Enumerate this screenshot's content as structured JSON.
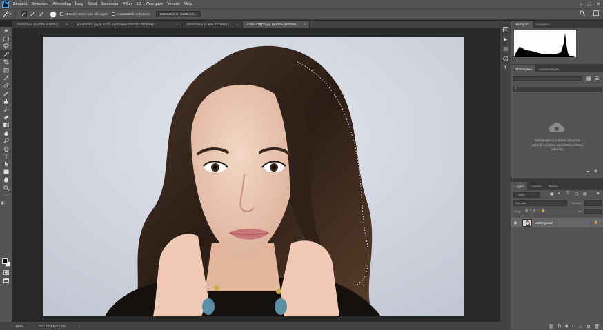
{
  "app": {
    "logo": "Ps"
  },
  "menu": [
    "Bestand",
    "Bewerken",
    "Afbeelding",
    "Laag",
    "Tekst",
    "Selecteren",
    "Filter",
    "3D",
    "Weergave",
    "Venster",
    "Help"
  ],
  "window_controls": {
    "minimize": "–",
    "maximize": "□",
    "close": "✕"
  },
  "options": {
    "brush_size": "47",
    "sample_all_layers": "Monster nemen van alle lagen",
    "auto_enhance": "Automatisch verbeteren",
    "select_mask_button": "Selecteren en maskeren..."
  },
  "tabs": [
    {
      "label": "Naamloos-1 @ 100% (RGB/8) *",
      "close": "×"
    },
    {
      "label": "girl-1848454.jpg @ 41,5% (radbouwne-2262233, RGB/8#) *",
      "close": "×"
    },
    {
      "label": "Naamloos-2 @ 50% (RGB/8#) *",
      "close": "×"
    },
    {
      "label": "model-429733.jpg @ 100% (RGB/8#)",
      "close": "×",
      "active": true
    }
  ],
  "status": {
    "zoom": "100%",
    "doc": "Doc: 13,7 M/13,7 M",
    "arrow": "›"
  },
  "panels": {
    "histogram_tabs": [
      "Histogram",
      "Navigator"
    ],
    "library_tabs": [
      "Bibliotheken",
      "Aanpassingen"
    ],
    "library_message": "Meld u aan bij Creative Cloud om gebruik te maken van Creative Cloud Libraries",
    "layers_tabs": [
      "Lagen",
      "Kanalen",
      "Paden"
    ],
    "layers_kind": "Soort",
    "blend_mode": "Normaal",
    "opacity_label": "Dekking:",
    "lock_label": "Vergr:",
    "fill_label": "Vul:",
    "layer_name": "Achtergrond"
  },
  "colors": {
    "accent": "#31a8ff",
    "panel": "#535353",
    "canvas_bg": "#282828"
  }
}
